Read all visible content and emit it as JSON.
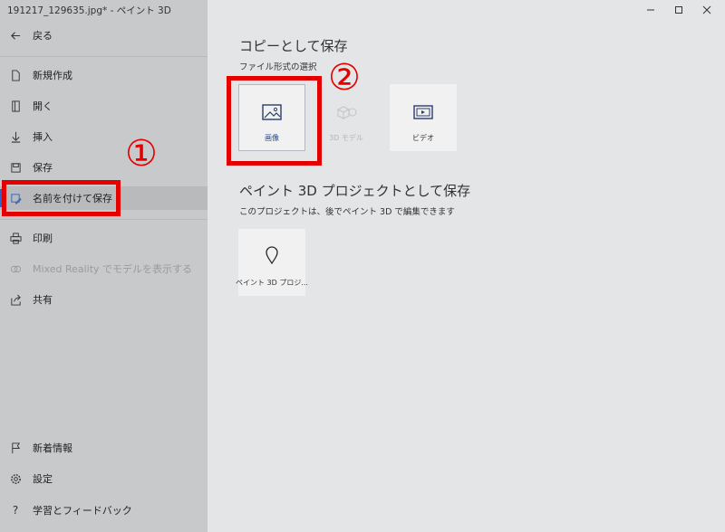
{
  "window": {
    "title": "191217_129635.jpg* - ペイント 3D"
  },
  "sidebar": {
    "back_label": "戻る",
    "items": [
      {
        "label": "新規作成"
      },
      {
        "label": "開く"
      },
      {
        "label": "挿入"
      },
      {
        "label": "保存"
      },
      {
        "label": "名前を付けて保存"
      },
      {
        "label": "印刷"
      },
      {
        "label": "Mixed Reality でモデルを表示する"
      },
      {
        "label": "共有"
      }
    ],
    "bottom_items": [
      {
        "label": "新着情報"
      },
      {
        "label": "設定"
      },
      {
        "label": "学習とフィードバック"
      }
    ]
  },
  "main": {
    "copy_section": {
      "title": "コピーとして保存",
      "subtitle": "ファイル形式の選択",
      "tiles": [
        {
          "label": "画像",
          "icon": "image-icon"
        },
        {
          "label": "3D モデル",
          "icon": "3d-model-icon"
        },
        {
          "label": "ビデオ",
          "icon": "video-icon"
        }
      ]
    },
    "project_section": {
      "title": "ペイント 3D プロジェクトとして保存",
      "subtitle": "このプロジェクトは、後でペイント 3D で編集できます",
      "tile": {
        "label": "ペイント 3D プロジ...",
        "icon": "paint3d-project-icon"
      }
    }
  },
  "annotations": {
    "step1": "①",
    "step2": "②",
    "color": "#e50000"
  },
  "colors": {
    "accent": "#2b63c8",
    "sidebar_bg": "#c8c9cb",
    "main_bg": "#e4e5e7"
  }
}
